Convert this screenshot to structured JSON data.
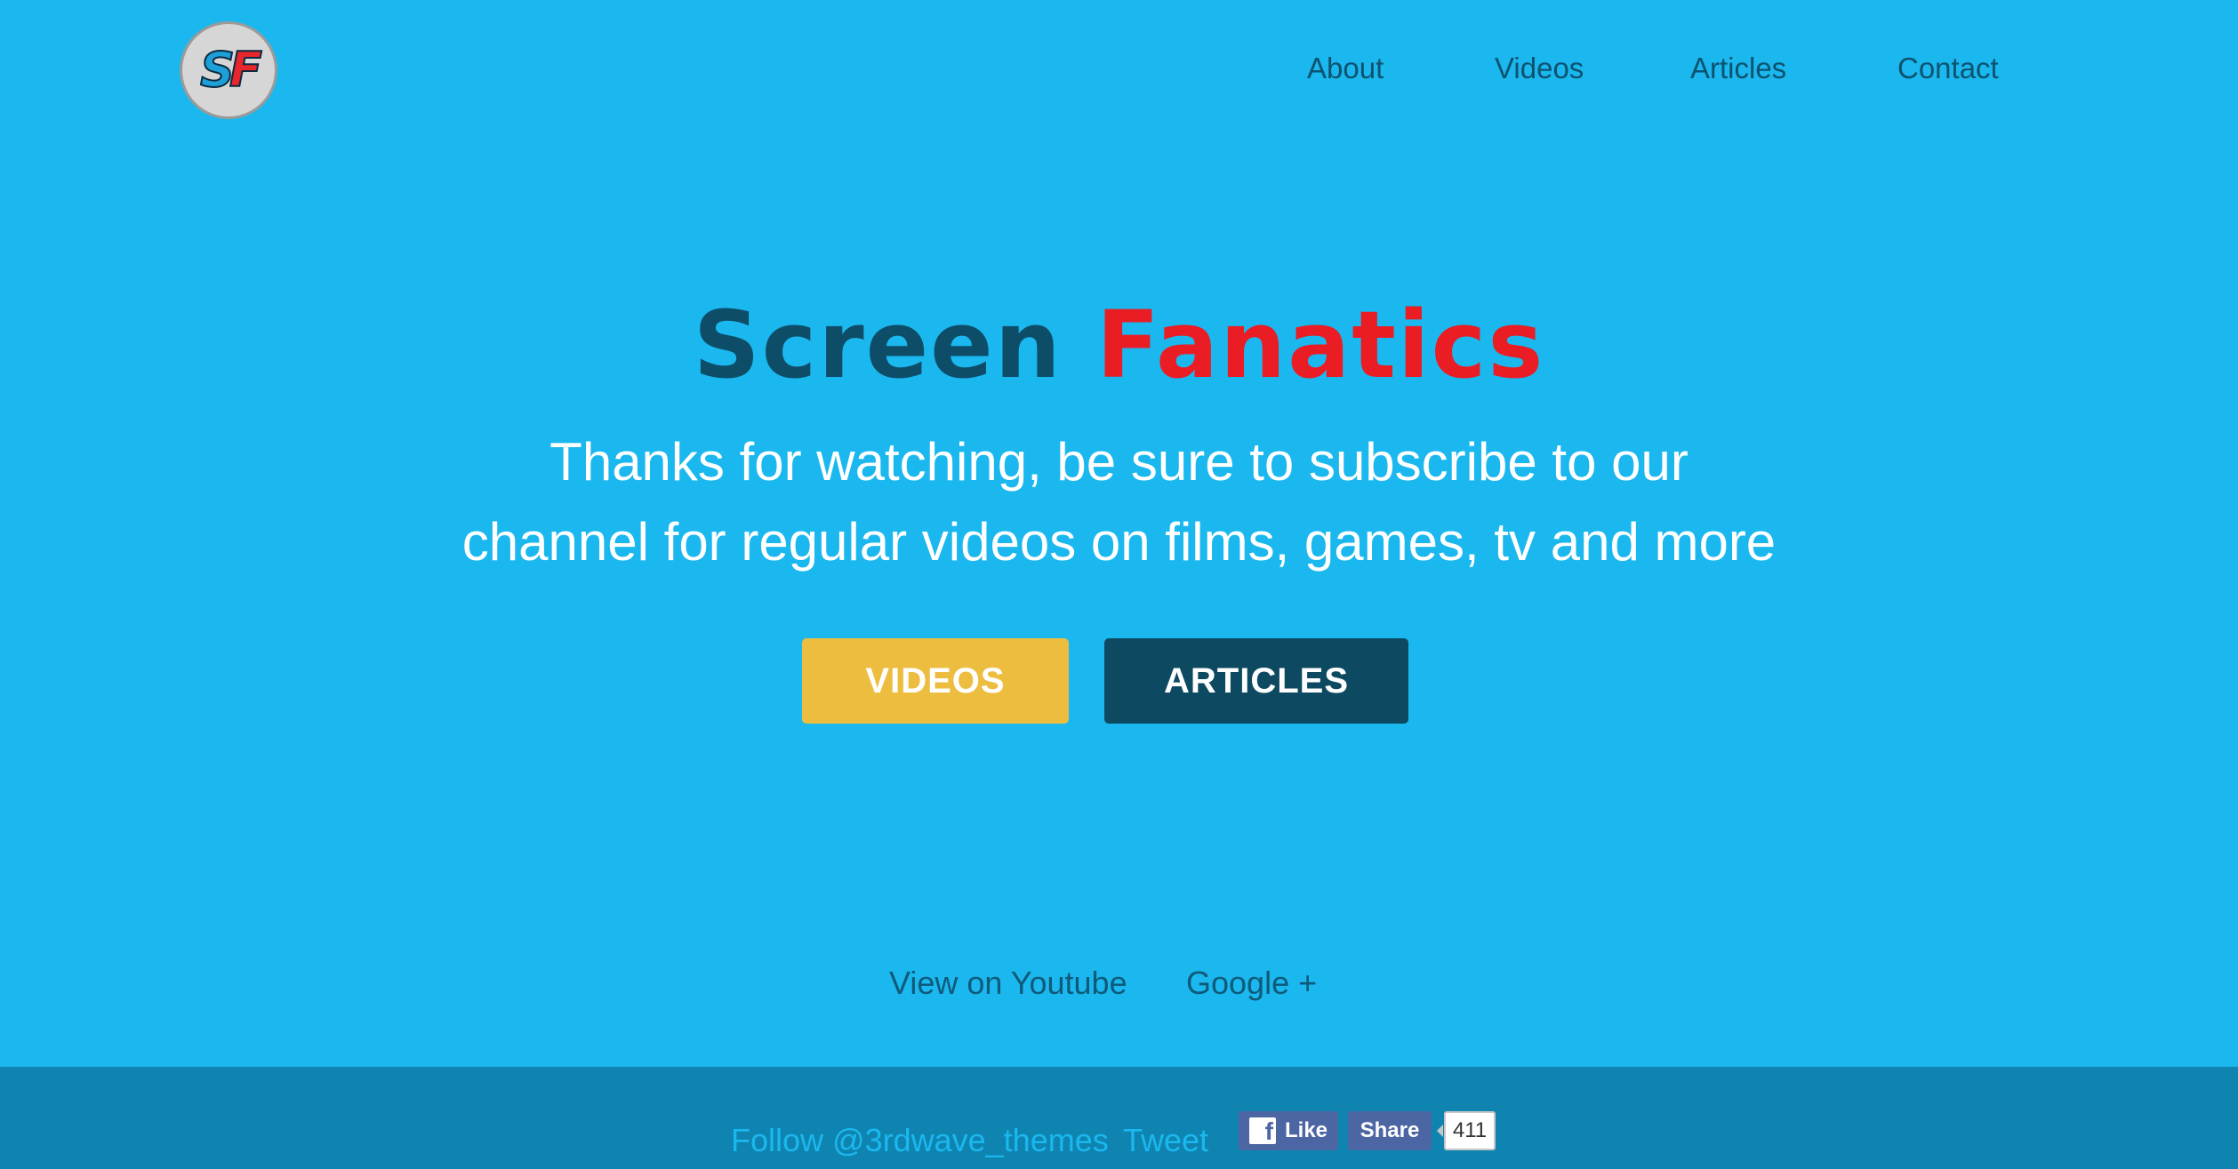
{
  "header": {
    "logo_text_s": "S",
    "logo_text_f": "F",
    "nav": [
      {
        "label": "About"
      },
      {
        "label": "Videos"
      },
      {
        "label": "Articles"
      },
      {
        "label": "Contact"
      }
    ]
  },
  "hero": {
    "title_word1": "Screen",
    "title_word2": "Fanatics",
    "subtitle_line1": "Thanks for watching, be sure to subscribe to our",
    "subtitle_line2": "channel for regular videos on films, games, tv and more",
    "buttons": {
      "videos": "VIDEOS",
      "articles": "ARTICLES"
    }
  },
  "links": {
    "youtube": "View on Youtube",
    "google": "Google +"
  },
  "footer": {
    "follow": "Follow @3rdwave_themes",
    "tweet": "Tweet",
    "fb_icon": "f",
    "fb_like": "Like",
    "fb_share": "Share",
    "fb_count": "411"
  },
  "colors": {
    "background": "#1ab8ee",
    "title_dark": "#0d4d68",
    "title_red": "#ea1c24",
    "button_yellow": "#ecbd3f",
    "button_dark": "#0d4a62",
    "footer": "#0f84b1",
    "facebook": "#4c66a4"
  }
}
